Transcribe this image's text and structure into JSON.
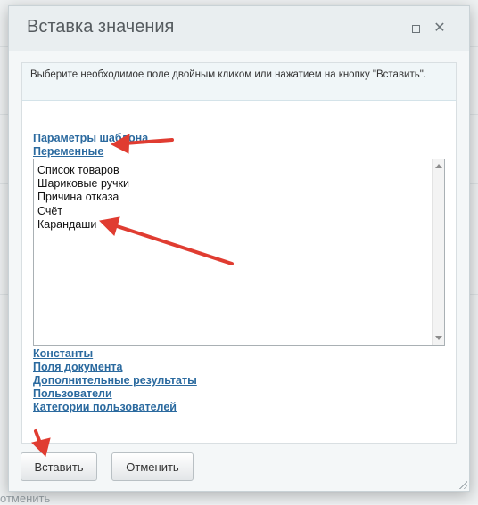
{
  "dialog": {
    "title": "Вставка значения",
    "hint": "Выберите необходимое поле двойным кликом или нажатием на кнопку \"Вставить\"."
  },
  "groups": {
    "template_params": "Параметры шаблона",
    "variables": "Переменные",
    "constants": "Константы",
    "document_fields": "Поля документа",
    "extra_results": "Дополнительные результаты",
    "users": "Пользователи",
    "user_categories": "Категории пользователей"
  },
  "variables_list": [
    "Список товаров",
    "Шариковые ручки",
    "Причина отказа",
    "Счёт",
    "Карандаши"
  ],
  "buttons": {
    "insert": "Вставить",
    "cancel": "Отменить"
  },
  "background": {
    "bottom_text": "отменить"
  },
  "icons": {
    "maximize": "maximize-icon",
    "close": "close-icon",
    "scroll_up": "chevron-up-icon",
    "scroll_down": "chevron-down-icon",
    "resize": "resize-grip-icon"
  },
  "colors": {
    "link": "#2b6a9f",
    "annotation_arrow": "#e03c31"
  }
}
